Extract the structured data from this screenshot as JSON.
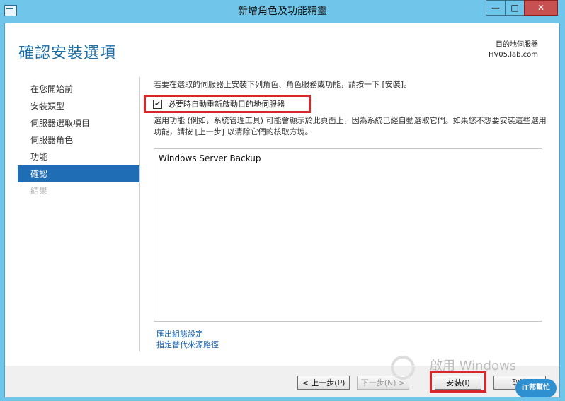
{
  "window": {
    "title": "新增角色及功能精靈"
  },
  "header": {
    "title": "確認安裝選項",
    "target_label": "目的地伺服器",
    "target_server": "HV05.lab.com"
  },
  "sidebar": {
    "items": [
      {
        "label": "在您開始前"
      },
      {
        "label": "安裝類型"
      },
      {
        "label": "伺服器選取項目"
      },
      {
        "label": "伺服器角色"
      },
      {
        "label": "功能"
      },
      {
        "label": "確認"
      },
      {
        "label": "結果"
      }
    ]
  },
  "content": {
    "intro": "若要在選取的伺服器上安裝下列角色、角色服務或功能，請按一下 [安裝]。",
    "restart_label": "必要時自動重新啟動目的地伺服器",
    "restart_checked": "✔",
    "note": "選用功能 (例如，系統管理工具) 可能會顯示於此頁面上，因為系統已經自動選取它們。如果您不想要安裝這些選用功能，請按 [上一步] 以清除它們的核取方塊。",
    "list_items": [
      "Windows Server Backup"
    ],
    "links": [
      "匯出組態設定",
      "指定替代來源路徑"
    ]
  },
  "footer": {
    "prev": "< 上一步(P)",
    "next": "下一步(N) >",
    "install": "安裝(I)",
    "cancel": "取消"
  },
  "watermark": {
    "line1": "啟用 Windows"
  },
  "brand": {
    "text": "iT邦幫忙"
  },
  "colors": {
    "titlebar": "#6fc6ea",
    "accent": "#1f6eb5",
    "highlight": "#d9262b"
  }
}
